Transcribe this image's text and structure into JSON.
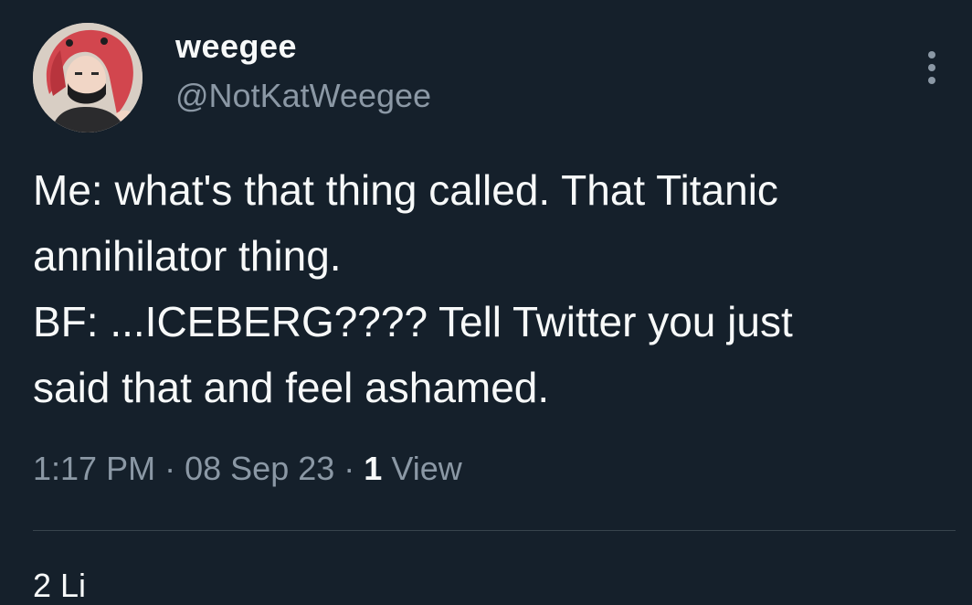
{
  "tweet": {
    "author": {
      "display_name": "weegee",
      "handle": "@NotKatWeegee"
    },
    "body_lines": [
      "Me: what's that thing called. That Titanic",
      "annihilator thing.",
      "BF: ...ICEBERG???? Tell Twitter you just",
      "said that and feel ashamed."
    ],
    "meta": {
      "time": "1:17 PM",
      "separator": "·",
      "date": "08 Sep 23",
      "views_count": "1",
      "views_label": "View"
    },
    "stats_partial": "2 Li"
  },
  "icons": {
    "more": "more-vertical-icon"
  },
  "colors": {
    "background": "#15202b",
    "primary_text": "#f7f9f9",
    "secondary_text": "#8b98a5",
    "divider": "#38444d"
  }
}
